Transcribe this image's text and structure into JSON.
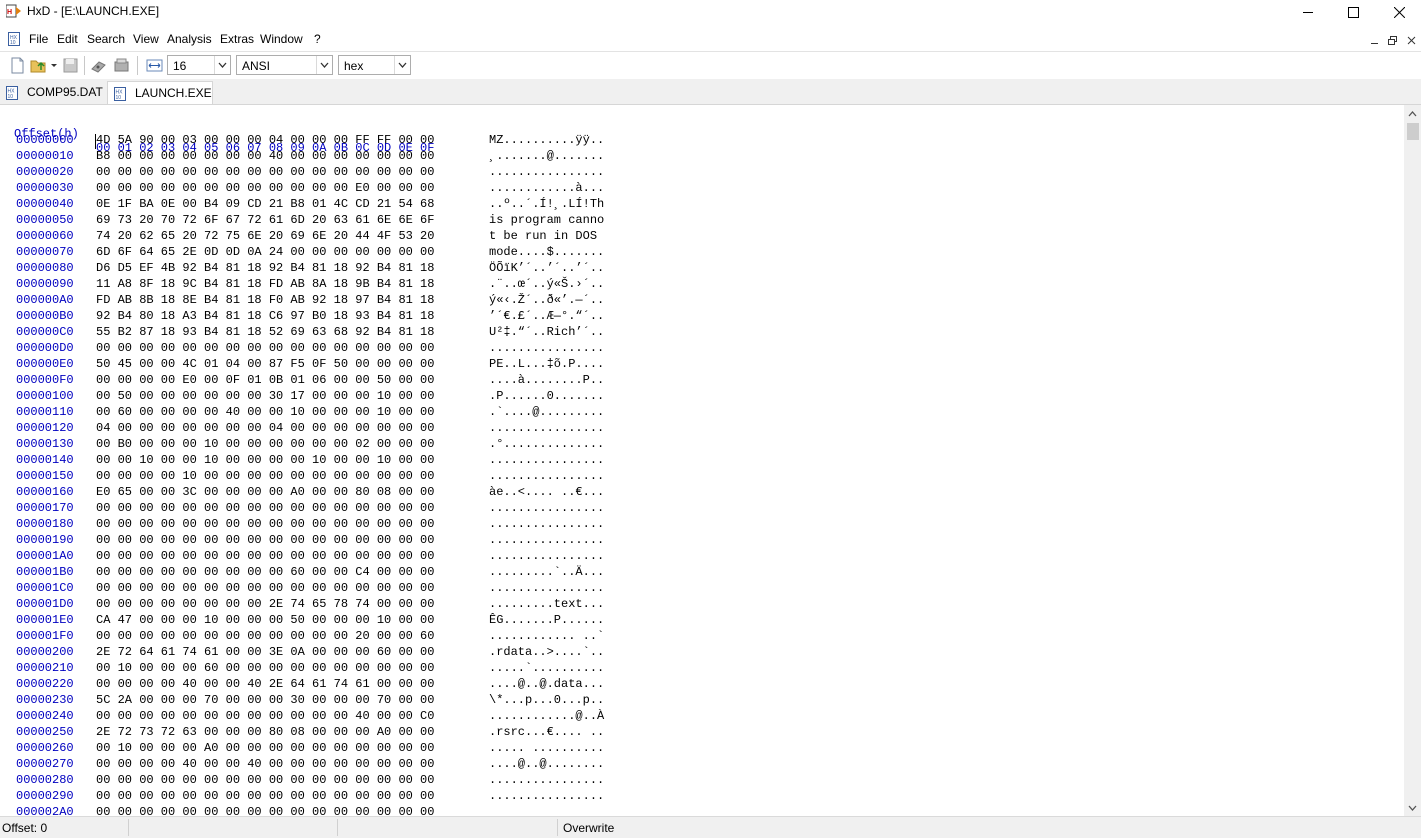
{
  "window": {
    "title": "HxD - [E:\\LAUNCH.EXE]"
  },
  "menu": [
    "File",
    "Edit",
    "Search",
    "View",
    "Analysis",
    "Extras",
    "Window",
    "?"
  ],
  "toolbar": {
    "bytes_per_row": "16",
    "charset": "ANSI",
    "offset_base": "hex"
  },
  "tabs": [
    {
      "label": "COMP95.DAT",
      "active": false
    },
    {
      "label": "LAUNCH.EXE",
      "active": true
    }
  ],
  "hex_view": {
    "offset_header": "Offset(h)",
    "column_header": "00 01 02 03 04 05 06 07 08 09 0A 0B 0C 0D 0E 0F",
    "rows": [
      {
        "offset": "00000000",
        "hex": "4D 5A 90 00 03 00 00 00 04 00 00 00 FF FF 00 00",
        "ascii": "MZ..........ÿÿ.."
      },
      {
        "offset": "00000010",
        "hex": "B8 00 00 00 00 00 00 00 40 00 00 00 00 00 00 00",
        "ascii": "¸.......@......."
      },
      {
        "offset": "00000020",
        "hex": "00 00 00 00 00 00 00 00 00 00 00 00 00 00 00 00",
        "ascii": "................"
      },
      {
        "offset": "00000030",
        "hex": "00 00 00 00 00 00 00 00 00 00 00 00 E0 00 00 00",
        "ascii": "............à..."
      },
      {
        "offset": "00000040",
        "hex": "0E 1F BA 0E 00 B4 09 CD 21 B8 01 4C CD 21 54 68",
        "ascii": "..º..´.Í!¸.LÍ!Th"
      },
      {
        "offset": "00000050",
        "hex": "69 73 20 70 72 6F 67 72 61 6D 20 63 61 6E 6E 6F",
        "ascii": "is program canno"
      },
      {
        "offset": "00000060",
        "hex": "74 20 62 65 20 72 75 6E 20 69 6E 20 44 4F 53 20",
        "ascii": "t be run in DOS "
      },
      {
        "offset": "00000070",
        "hex": "6D 6F 64 65 2E 0D 0D 0A 24 00 00 00 00 00 00 00",
        "ascii": "mode....$......."
      },
      {
        "offset": "00000080",
        "hex": "D6 D5 EF 4B 92 B4 81 18 92 B4 81 18 92 B4 81 18",
        "ascii": "ÖÕïK’´..’´..’´.."
      },
      {
        "offset": "00000090",
        "hex": "11 A8 8F 18 9C B4 81 18 FD AB 8A 18 9B B4 81 18",
        "ascii": ".¨..œ´..ý«Š.›´.."
      },
      {
        "offset": "000000A0",
        "hex": "FD AB 8B 18 8E B4 81 18 F0 AB 92 18 97 B4 81 18",
        "ascii": "ý«‹.Ž´..ð«’.—´.."
      },
      {
        "offset": "000000B0",
        "hex": "92 B4 80 18 A3 B4 81 18 C6 97 B0 18 93 B4 81 18",
        "ascii": "’´€.£´..Æ—°.“´.."
      },
      {
        "offset": "000000C0",
        "hex": "55 B2 87 18 93 B4 81 18 52 69 63 68 92 B4 81 18",
        "ascii": "U²‡.“´..Rich’´.."
      },
      {
        "offset": "000000D0",
        "hex": "00 00 00 00 00 00 00 00 00 00 00 00 00 00 00 00",
        "ascii": "................"
      },
      {
        "offset": "000000E0",
        "hex": "50 45 00 00 4C 01 04 00 87 F5 0F 50 00 00 00 00",
        "ascii": "PE..L...‡õ.P...."
      },
      {
        "offset": "000000F0",
        "hex": "00 00 00 00 E0 00 0F 01 0B 01 06 00 00 50 00 00",
        "ascii": "....à........P.."
      },
      {
        "offset": "00000100",
        "hex": "00 50 00 00 00 00 00 00 30 17 00 00 00 10 00 00",
        "ascii": ".P......0......."
      },
      {
        "offset": "00000110",
        "hex": "00 60 00 00 00 00 40 00 00 10 00 00 00 10 00 00",
        "ascii": ".`....@........."
      },
      {
        "offset": "00000120",
        "hex": "04 00 00 00 00 00 00 00 04 00 00 00 00 00 00 00",
        "ascii": "................"
      },
      {
        "offset": "00000130",
        "hex": "00 B0 00 00 00 10 00 00 00 00 00 00 02 00 00 00",
        "ascii": ".°.............."
      },
      {
        "offset": "00000140",
        "hex": "00 00 10 00 00 10 00 00 00 00 10 00 00 10 00 00",
        "ascii": "................"
      },
      {
        "offset": "00000150",
        "hex": "00 00 00 00 10 00 00 00 00 00 00 00 00 00 00 00",
        "ascii": "................"
      },
      {
        "offset": "00000160",
        "hex": "E0 65 00 00 3C 00 00 00 00 A0 00 00 80 08 00 00",
        "ascii": "àe..<.... ..€..."
      },
      {
        "offset": "00000170",
        "hex": "00 00 00 00 00 00 00 00 00 00 00 00 00 00 00 00",
        "ascii": "................"
      },
      {
        "offset": "00000180",
        "hex": "00 00 00 00 00 00 00 00 00 00 00 00 00 00 00 00",
        "ascii": "................"
      },
      {
        "offset": "00000190",
        "hex": "00 00 00 00 00 00 00 00 00 00 00 00 00 00 00 00",
        "ascii": "................"
      },
      {
        "offset": "000001A0",
        "hex": "00 00 00 00 00 00 00 00 00 00 00 00 00 00 00 00",
        "ascii": "................"
      },
      {
        "offset": "000001B0",
        "hex": "00 00 00 00 00 00 00 00 00 60 00 00 C4 00 00 00",
        "ascii": ".........`..Ä..."
      },
      {
        "offset": "000001C0",
        "hex": "00 00 00 00 00 00 00 00 00 00 00 00 00 00 00 00",
        "ascii": "................"
      },
      {
        "offset": "000001D0",
        "hex": "00 00 00 00 00 00 00 00 2E 74 65 78 74 00 00 00",
        "ascii": ".........text..."
      },
      {
        "offset": "000001E0",
        "hex": "CA 47 00 00 00 10 00 00 00 50 00 00 00 10 00 00",
        "ascii": "ÊG.......P......"
      },
      {
        "offset": "000001F0",
        "hex": "00 00 00 00 00 00 00 00 00 00 00 00 20 00 00 60",
        "ascii": "............ ..`"
      },
      {
        "offset": "00000200",
        "hex": "2E 72 64 61 74 61 00 00 3E 0A 00 00 00 60 00 00",
        "ascii": ".rdata..>....`.."
      },
      {
        "offset": "00000210",
        "hex": "00 10 00 00 00 60 00 00 00 00 00 00 00 00 00 00",
        "ascii": ".....`.........."
      },
      {
        "offset": "00000220",
        "hex": "00 00 00 00 40 00 00 40 2E 64 61 74 61 00 00 00",
        "ascii": "....@..@.data..."
      },
      {
        "offset": "00000230",
        "hex": "5C 2A 00 00 00 70 00 00 00 30 00 00 00 70 00 00",
        "ascii": "\\*...p...0...p.."
      },
      {
        "offset": "00000240",
        "hex": "00 00 00 00 00 00 00 00 00 00 00 00 40 00 00 C0",
        "ascii": "............@..À"
      },
      {
        "offset": "00000250",
        "hex": "2E 72 73 72 63 00 00 00 80 08 00 00 00 A0 00 00",
        "ascii": ".rsrc...€.... .."
      },
      {
        "offset": "00000260",
        "hex": "00 10 00 00 00 A0 00 00 00 00 00 00 00 00 00 00",
        "ascii": "..... .........."
      },
      {
        "offset": "00000270",
        "hex": "00 00 00 00 40 00 00 40 00 00 00 00 00 00 00 00",
        "ascii": "....@..@........"
      },
      {
        "offset": "00000280",
        "hex": "00 00 00 00 00 00 00 00 00 00 00 00 00 00 00 00",
        "ascii": "................"
      },
      {
        "offset": "00000290",
        "hex": "00 00 00 00 00 00 00 00 00 00 00 00 00 00 00 00",
        "ascii": "................"
      },
      {
        "offset": "000002A0",
        "hex": "00 00 00 00 00 00 00 00 00 00 00 00 00 00 00 00",
        "ascii": ""
      }
    ]
  },
  "status": {
    "offset": "Offset: 0",
    "mode": "Overwrite"
  },
  "colors": {
    "offset_blue": "#0000c0",
    "status_bg": "#f0f0f0"
  }
}
